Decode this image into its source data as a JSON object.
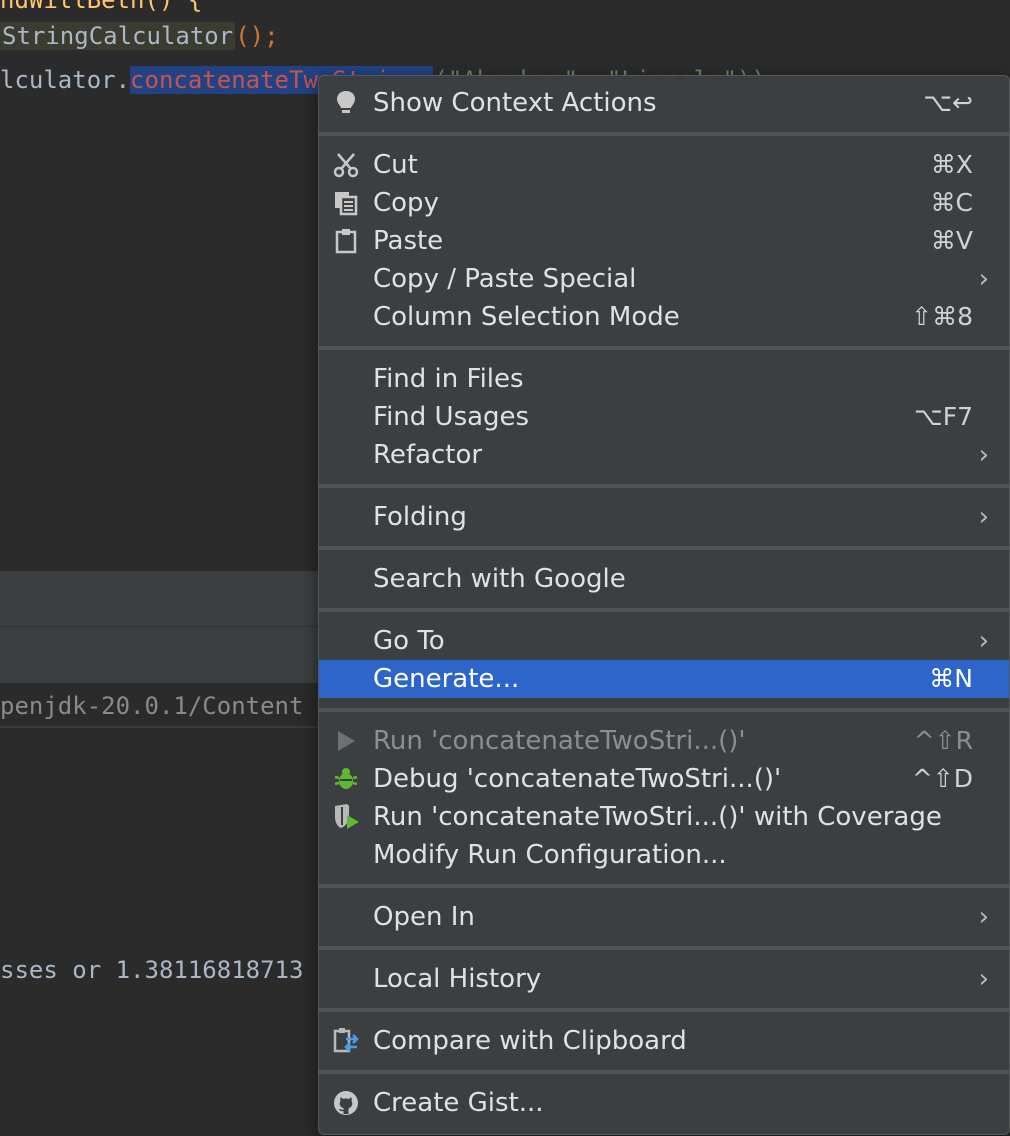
{
  "editor": {
    "line0": "ndWillBeth() {",
    "line1_usage": "StringCalculator",
    "line1_punct": "();",
    "line2_prefix": "lculator.",
    "line2_selected": "concatenateTwoStrings",
    "line2_args": "(\"Abraham\", \"Lincoln\"));"
  },
  "console": {
    "line1": "penjdk-20.0.1/Content",
    "line2": "sses or 1.38116818713"
  },
  "menu": {
    "items": [
      {
        "label": "Show Context Actions",
        "shortcut": "⌥↩",
        "icon": "lightbulb-icon"
      },
      {
        "label": "Cut",
        "shortcut": "⌘X",
        "icon": "scissors-icon"
      },
      {
        "label": "Copy",
        "shortcut": "⌘C",
        "icon": "copy-icon"
      },
      {
        "label": "Paste",
        "shortcut": "⌘V",
        "icon": "clipboard-icon"
      },
      {
        "label": "Copy / Paste Special",
        "submenu": true
      },
      {
        "label": "Column Selection Mode",
        "shortcut": "⇧⌘8"
      },
      {
        "label": "Find in Files"
      },
      {
        "label": "Find Usages",
        "shortcut": "⌥F7"
      },
      {
        "label": "Refactor",
        "submenu": true
      },
      {
        "label": "Folding",
        "submenu": true
      },
      {
        "label": "Search with Google"
      },
      {
        "label": "Go To",
        "submenu": true
      },
      {
        "label": "Generate...",
        "shortcut": "⌘N",
        "selected": true
      },
      {
        "label": "Run 'concatenateTwoStri...()'",
        "shortcut": "^⇧R",
        "icon": "run-icon",
        "disabled": true
      },
      {
        "label": "Debug 'concatenateTwoStri...()'",
        "shortcut": "^⇧D",
        "icon": "debug-bug-icon"
      },
      {
        "label": "Run 'concatenateTwoStri...()' with Coverage",
        "icon": "coverage-shield-icon"
      },
      {
        "label": "Modify Run Configuration..."
      },
      {
        "label": "Open In",
        "submenu": true
      },
      {
        "label": "Local History",
        "submenu": true
      },
      {
        "label": "Compare with Clipboard",
        "icon": "compare-clipboard-icon"
      },
      {
        "label": "Create Gist...",
        "icon": "github-icon"
      }
    ],
    "submenu_arrow": "›"
  },
  "colors": {
    "editor_bg": "#2b2b2b",
    "menu_bg": "#3c3f41",
    "selection": "#2d65cb",
    "selected_code_bg": "#214283",
    "debug_green": "#5fb832"
  }
}
